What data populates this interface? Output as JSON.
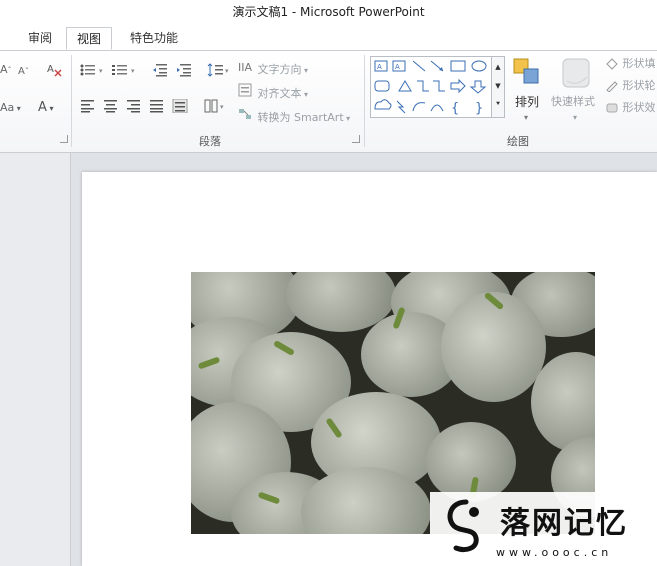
{
  "window": {
    "title": "演示文稿1 - Microsoft PowerPoint"
  },
  "tabs": [
    {
      "label": "审阅",
      "active": false
    },
    {
      "label": "视图",
      "active": true
    },
    {
      "label": "特色功能",
      "active": false
    }
  ],
  "ribbon": {
    "paragraph": {
      "label": "段落",
      "text_direction": "文字方向",
      "align_text": "对齐文本",
      "convert_smartart": "转换为 SmartArt"
    },
    "drawing": {
      "label": "绘图",
      "arrange": "排列",
      "quick_styles": "快速样式",
      "shape_fill": "形状填",
      "shape_outline": "形状轮",
      "shape_effects": "形状效"
    },
    "font_fragments": {
      "a_big": "A",
      "a_small": "A",
      "aa": "Aa",
      "a_color": "A"
    }
  },
  "watermark": {
    "title": "落网记忆",
    "url": "www.oooc.cn"
  },
  "colors": {
    "accent": "#2b579a",
    "ribbon_bg": "#f4f5f7",
    "workspace": "#dfe2e6"
  }
}
